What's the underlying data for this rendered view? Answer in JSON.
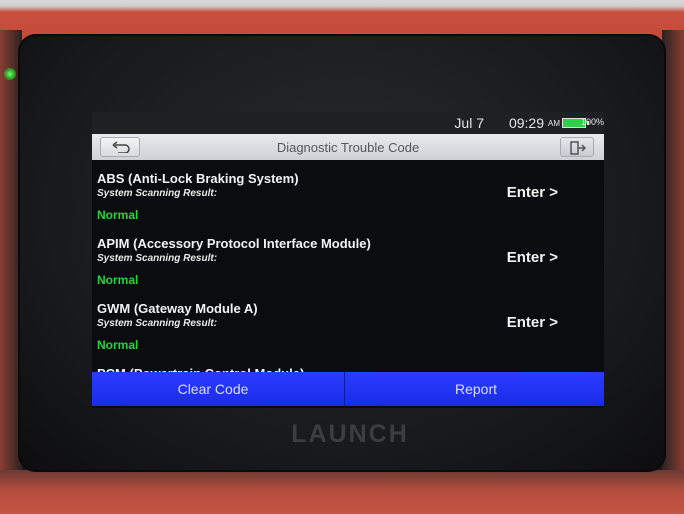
{
  "device": {
    "brand": "LAUNCH"
  },
  "status_bar": {
    "date": "Jul 7",
    "time": "09:29",
    "ampm": "AM",
    "battery": "100%"
  },
  "header": {
    "title": "Diagnostic Trouble Code"
  },
  "systems": [
    {
      "name": "ABS (Anti-Lock Braking System)",
      "sub": "System Scanning Result:",
      "status": "Normal",
      "enter": "Enter >"
    },
    {
      "name": "APIM (Accessory Protocol Interface Module)",
      "sub": "System Scanning Result:",
      "status": "Normal",
      "enter": "Enter >"
    },
    {
      "name": "GWM (Gateway Module A)",
      "sub": "System Scanning Result:",
      "status": "Normal",
      "enter": "Enter >"
    },
    {
      "name": "PCM (Powertrain Control Module)"
    }
  ],
  "footer": {
    "clear_label": "Clear Code",
    "report_label": "Report"
  },
  "colors": {
    "accent": "#2233ff",
    "normal": "#2bd23a"
  }
}
